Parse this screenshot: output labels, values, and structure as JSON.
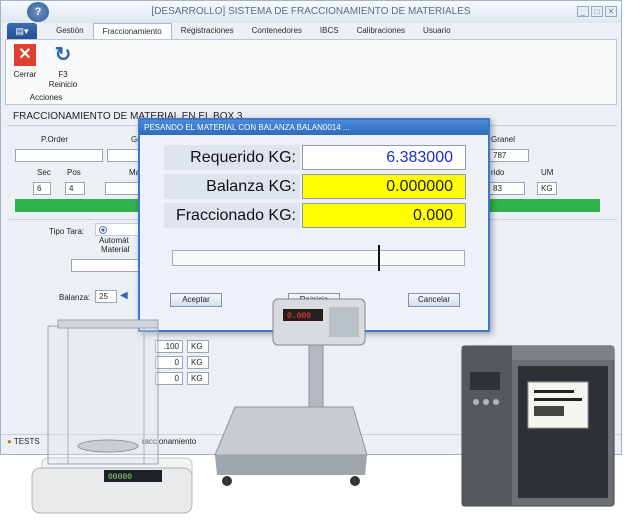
{
  "window": {
    "title": "[DESARROLLO] SISTEMA DE FRACCIONAMIENTO DE MATERIALES",
    "qat_label": "?",
    "controls": [
      "_",
      "□",
      "✕"
    ]
  },
  "tabs": [
    {
      "label": "Gestión"
    },
    {
      "label": "Fraccionamiento",
      "active": true
    },
    {
      "label": "Registraciones"
    },
    {
      "label": "Contenedores"
    },
    {
      "label": "IBCS"
    },
    {
      "label": "Calibraciones"
    },
    {
      "label": "Usuario"
    }
  ],
  "ribbon": {
    "close_label": "Cerrar",
    "f3_label": "F3",
    "reload_label": "Reinicio",
    "group_label": "Acciones"
  },
  "panel": {
    "title": "FRACCIONAMIENTO DE MATERIAL EN EL BOX 3",
    "porder_label": "P.Order",
    "gr_label": "Gr",
    "sec_label": "Sec",
    "sec_value": "6",
    "pos_label": "Pos",
    "pos_value": "4",
    "ma_label": "Ma",
    "granel_label": "Granel",
    "granel_value": "787",
    "rido_label": "rido",
    "rido_value": "83",
    "um_label": "UM",
    "um_value": "KG",
    "tipo_tara_label": "Tipo Tara:",
    "tipo_tara_value": "Automát",
    "material_label": "Material",
    "balanza_label": "Balanza:",
    "balanza_value": "25",
    "row_values": [
      ".100",
      "0",
      "0"
    ],
    "row_units": [
      "KG",
      "KG",
      "KG"
    ]
  },
  "statusbar": {
    "user_text": "TESTS",
    "module_text": "raccionamiento"
  },
  "dialog": {
    "title": "PESANDO EL MATERIAL CON BALANZA BALAN0014 ...",
    "requerido_label": "Requerido KG:",
    "requerido_value": "6.383000",
    "balanza_label": "Balanza KG:",
    "balanza_value": "0.000000",
    "fraccionado_label": "Fraccionado KG:",
    "fraccionado_value": "0.000",
    "aceptar": "Aceptar",
    "reinicio": "Reinicio",
    "cancelar": "Cancelar"
  },
  "devices": {
    "scale_display": "0.000",
    "balance_display": "00000"
  },
  "colors": {
    "accent": "#2e6cbc",
    "highlight": "#ffff00",
    "required_text": "#1a2bd6",
    "progress_green": "#2fb34a"
  }
}
